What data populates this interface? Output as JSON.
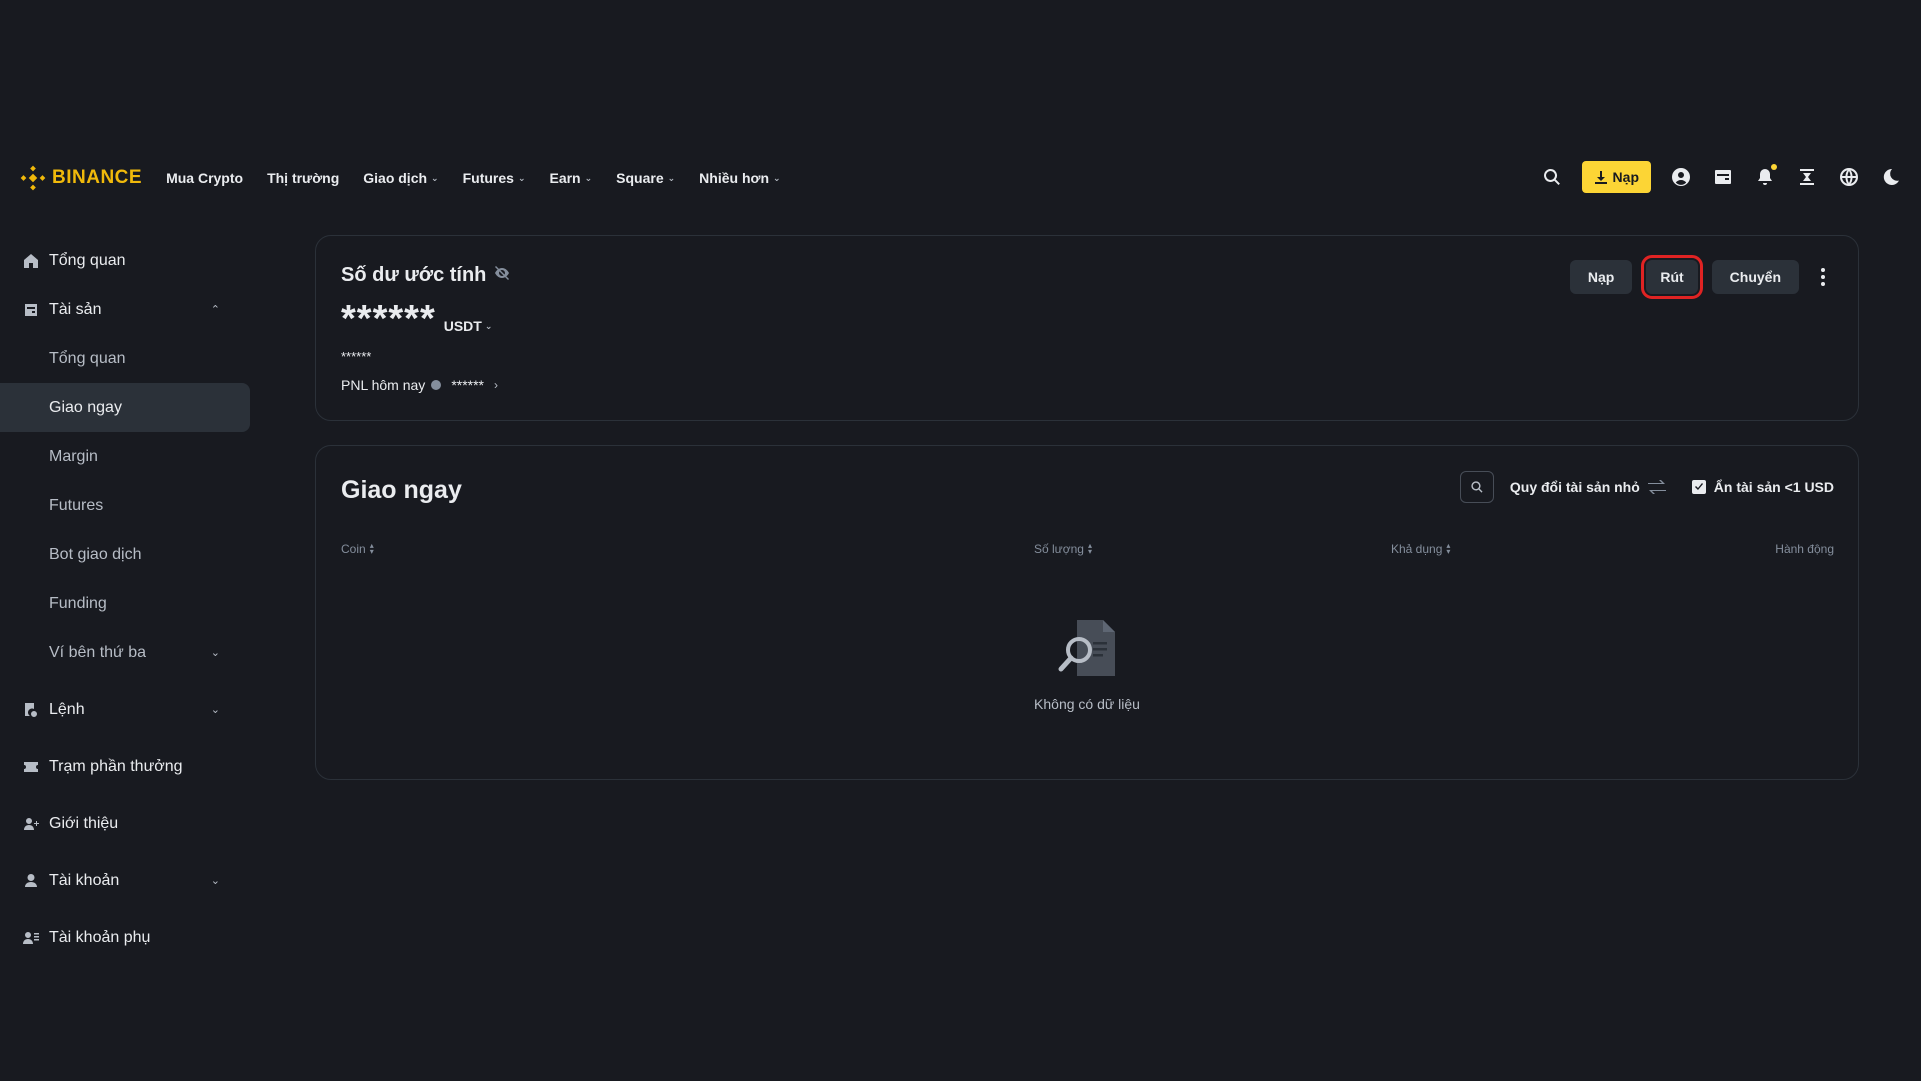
{
  "brand": {
    "name": "BINANCE",
    "color": "#f0b90b"
  },
  "nav": {
    "items": [
      {
        "label": "Mua Crypto",
        "dropdown": false
      },
      {
        "label": "Thị trường",
        "dropdown": false
      },
      {
        "label": "Giao dịch",
        "dropdown": true
      },
      {
        "label": "Futures",
        "dropdown": true
      },
      {
        "label": "Earn",
        "dropdown": true
      },
      {
        "label": "Square",
        "dropdown": true
      },
      {
        "label": "Nhiều hơn",
        "dropdown": true
      }
    ],
    "deposit_label": "Nạp",
    "icons": [
      "search-icon",
      "download-icon",
      "user-icon",
      "wallet-icon",
      "bell-icon",
      "transfer-icon",
      "globe-icon",
      "moon-icon"
    ]
  },
  "sidebar": {
    "overview": "Tổng quan",
    "assets": "Tài sản",
    "assets_sub": [
      "Tổng quan",
      "Giao ngay",
      "Margin",
      "Futures",
      "Bot giao dịch",
      "Funding",
      "Ví bên thứ ba"
    ],
    "orders": "Lệnh",
    "rewards": "Trạm phần thưởng",
    "referral": "Giới thiệu",
    "account": "Tài khoản",
    "sub_account": "Tài khoản phụ"
  },
  "balance": {
    "title": "Số dư ước tính",
    "value": "******",
    "unit": "USDT",
    "sub_value": "******",
    "pnl_label": "PNL hôm nay",
    "pnl_value": "******",
    "actions": {
      "deposit": "Nạp",
      "withdraw": "Rút",
      "transfer": "Chuyển"
    }
  },
  "spot": {
    "title": "Giao ngay",
    "convert_label": "Quy đổi tài sản nhỏ",
    "hide_small_label": "Ẩn tài sản <1 USD",
    "hide_small_checked": true,
    "columns": {
      "coin": "Coin",
      "amount": "Số lượng",
      "available": "Khả dụng",
      "action": "Hành động"
    },
    "empty_text": "Không có dữ liệu"
  },
  "colors": {
    "background": "#181a20",
    "panel": "#2b3139",
    "accent": "#fcd535",
    "highlight": "#e02323"
  }
}
